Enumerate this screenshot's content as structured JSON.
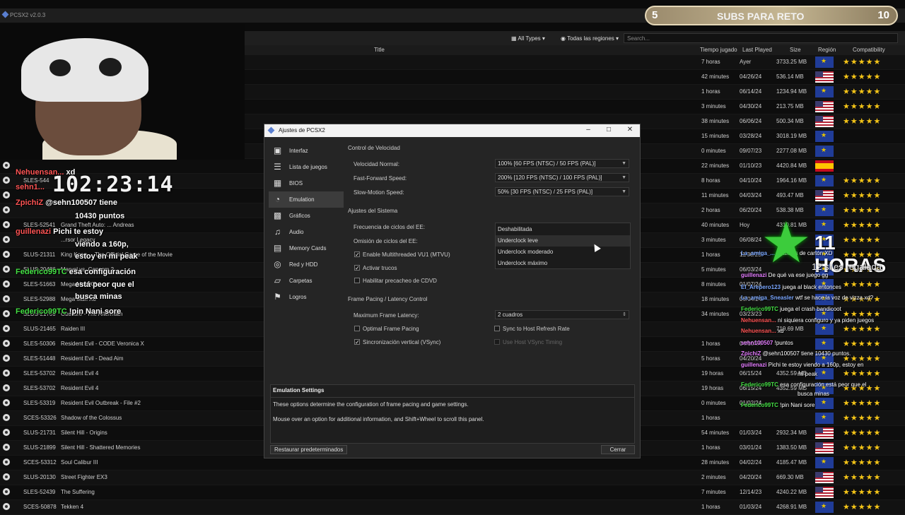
{
  "app": {
    "title": "PCSX2 v2.0.3"
  },
  "toolbar": {
    "types": "All Types",
    "regions": "Todas las regiones",
    "search_placeholder": "Search..."
  },
  "columns": {
    "title": "Title",
    "time": "Tiempo jugado",
    "last": "Last Played",
    "size": "Size",
    "region": "Región",
    "compat": "Compatibility"
  },
  "games": [
    {
      "serial": "",
      "title": "",
      "time": "7 horas",
      "last": "Ayer",
      "size": "3733.25 MB",
      "flag": "eu",
      "stars": 5
    },
    {
      "serial": "",
      "title": "",
      "time": "42 minutes",
      "last": "04/26/24",
      "size": "536.14 MB",
      "flag": "us",
      "stars": 5
    },
    {
      "serial": "",
      "title": "",
      "time": "1 horas",
      "last": "06/14/24",
      "size": "1234.94 MB",
      "flag": "eu",
      "stars": 5
    },
    {
      "serial": "",
      "title": "",
      "time": "3 minutes",
      "last": "04/30/24",
      "size": "213.75 MB",
      "flag": "us",
      "stars": 5
    },
    {
      "serial": "",
      "title": "",
      "time": "38 minutes",
      "last": "06/06/24",
      "size": "500.34 MB",
      "flag": "us",
      "stars": 5
    },
    {
      "serial": "",
      "title": "",
      "time": "15 minutes",
      "last": "03/28/24",
      "size": "3018.19 MB",
      "flag": "eu",
      "stars": 0
    },
    {
      "serial": "",
      "title": "",
      "time": "0 minutes",
      "last": "09/07/23",
      "size": "2277.08 MB",
      "flag": "eu",
      "stars": 0
    },
    {
      "serial": "",
      "title": "",
      "time": "22 minutes",
      "last": "01/10/23",
      "size": "4420.84 MB",
      "flag": "es",
      "stars": 0
    },
    {
      "serial": "SLES-544",
      "title": "",
      "time": "8 horas",
      "last": "04/10/24",
      "size": "1964.16 MB",
      "flag": "eu",
      "stars": 5
    },
    {
      "serial": "",
      "title": "",
      "time": "11 minutes",
      "last": "04/03/24",
      "size": "493.47 MB",
      "flag": "us",
      "stars": 5
    },
    {
      "serial": "",
      "title": "",
      "time": "2 horas",
      "last": "06/20/24",
      "size": "538.38 MB",
      "flag": "eu",
      "stars": 5
    },
    {
      "serial": "SLES-52541",
      "title": "Grand Theft Auto: ... Andreas",
      "time": "40 minutes",
      "last": "Hoy",
      "size": "4310.81 MB",
      "flag": "eu",
      "stars": 5
    },
    {
      "serial": "",
      "title": "...rsor Legacy",
      "time": "3 minutes",
      "last": "06/08/24",
      "size": "",
      "flag": "eu",
      "stars": 5
    },
    {
      "serial": "SLUS-21311",
      "title": "King Kong ... The Official Game of the Movie",
      "time": "1 horas",
      "last": "11/30/23",
      "size": "",
      "flag": "eu",
      "stars": 5
    },
    {
      "serial": "SLUS-20486",
      "title": "Marvel vs. Capcom 2",
      "time": "5 minutes",
      "last": "06/03/24",
      "size": "",
      "flag": "eu",
      "stars": 5
    },
    {
      "serial": "SLES-51663",
      "title": "Mega Man X7",
      "time": "8 minutes",
      "last": "01/07/24",
      "size": "",
      "flag": "eu",
      "stars": 5
    },
    {
      "serial": "SLES-52988",
      "title": "Mega Man X8",
      "time": "18 minutes",
      "last": "05/04/24",
      "size": "",
      "flag": "eu",
      "stars": 5
    },
    {
      "serial": "SLUS-21709",
      "title": "Obscure - The Aftermath",
      "time": "34 minutes",
      "last": "03/23/23",
      "size": "",
      "flag": "eu",
      "stars": 5
    },
    {
      "serial": "SLUS-21465",
      "title": "Raiden III",
      "time": "",
      "last": "",
      "size": "719.69 MB",
      "flag": "eu",
      "stars": 5
    },
    {
      "serial": "SLES-50306",
      "title": "Resident Evil - CODE Veronica X",
      "time": "1 horas",
      "last": "04/10/24",
      "size": "",
      "flag": "eu",
      "stars": 5
    },
    {
      "serial": "SLES-51448",
      "title": "Resident Evil - Dead Aim",
      "time": "5 horas",
      "last": "04/20/24",
      "size": "",
      "flag": "eu",
      "stars": 5
    },
    {
      "serial": "SLES-53702",
      "title": "Resident Evil 4",
      "time": "19 horas",
      "last": "06/15/24",
      "size": "4352.59 MB",
      "flag": "eu",
      "stars": 5
    },
    {
      "serial": "SLES-53702",
      "title": "Resident Evil 4",
      "time": "19 horas",
      "last": "06/15/24",
      "size": "4352.59 MB",
      "flag": "eu",
      "stars": 5
    },
    {
      "serial": "SLES-53319",
      "title": "Resident Evil Outbreak - File #2",
      "time": "0 minutes",
      "last": "01/02/24",
      "size": "",
      "flag": "eu",
      "stars": 5
    },
    {
      "serial": "SCES-53326",
      "title": "Shadow of the Colossus",
      "time": "1 horas",
      "last": "",
      "size": "",
      "flag": "eu",
      "stars": 5
    },
    {
      "serial": "SLUS-21731",
      "title": "Silent Hill - Origins",
      "time": "54 minutes",
      "last": "01/03/24",
      "size": "2932.34 MB",
      "flag": "us",
      "stars": 5
    },
    {
      "serial": "SLUS-21899",
      "title": "Silent Hill - Shattered Memories",
      "time": "1 horas",
      "last": "03/01/24",
      "size": "1383.50 MB",
      "flag": "us",
      "stars": 5
    },
    {
      "serial": "SCES-53312",
      "title": "Soul Calibur III",
      "time": "28 minutes",
      "last": "04/02/24",
      "size": "4185.47 MB",
      "flag": "eu",
      "stars": 5
    },
    {
      "serial": "SLUS-20130",
      "title": "Street Fighter EX3",
      "time": "2 minutes",
      "last": "04/20/24",
      "size": "669.30 MB",
      "flag": "us",
      "stars": 5
    },
    {
      "serial": "SLES-52439",
      "title": "The Suffering",
      "time": "7 minutes",
      "last": "12/14/23",
      "size": "4240.22 MB",
      "flag": "us",
      "stars": 5
    },
    {
      "serial": "SCES-50878",
      "title": "Tekken 4",
      "time": "1 horas",
      "last": "01/03/24",
      "size": "4268.91 MB",
      "flag": "eu",
      "stars": 5
    }
  ],
  "overlay": {
    "timer": "102:23:14",
    "subs_left": "5",
    "subs_label": "SUBS PARA RETO",
    "subs_right": "10",
    "hours_big": "11 HORAS",
    "hours_sub": "12 si es regalada"
  },
  "chat_left": [
    {
      "user": "Nehuensan...",
      "text": " xd"
    },
    {
      "user": "sehn1...",
      "text": ""
    },
    {
      "user": "ZpichiZ",
      "text": " @sehn100507 tiene"
    },
    {
      "user": "",
      "text": "10430 puntos"
    },
    {
      "user": "guillenazi",
      "text": " Pichi te estoy"
    },
    {
      "user": "",
      "text": "viendo a 160p,"
    },
    {
      "user": "",
      "text": "estoy en mi peak"
    },
    {
      "user": "Federico99TC",
      "text": " esa configuración"
    },
    {
      "user": "",
      "text": "está peor que el"
    },
    {
      "user": "",
      "text": "busca minas"
    },
    {
      "user": "Federico99TC",
      "text": " !pin Nani sore"
    }
  ],
  "chat_right": [
    {
      "user": "La_amiga_...",
      "text": " ...ráficos de cartón XD"
    },
    {
      "user": "guillenazi",
      "text": " De qué va ese juego gg"
    },
    {
      "user": "El_Arepero123",
      "text": " juega al black entonces"
    },
    {
      "user": "La_amiga_Sneasler",
      "text": " wtf se hace la voz de vizza xd?"
    },
    {
      "user": "Federico99TC",
      "text": " juega el crash bandicoot"
    },
    {
      "user": "Nehuensan...",
      "text": " ni siquiera configuro y ya piden juegos"
    },
    {
      "user": "Nehuensan...",
      "text": " xd"
    },
    {
      "user": "sehn100507",
      "text": " !puntos"
    },
    {
      "user": "ZpichiZ",
      "text": " @sehn100507 tiene 10430 puntos."
    },
    {
      "user": "guillenazi",
      "text": " Pichi te estoy viendo a 160p, estoy en"
    },
    {
      "user": "",
      "text": "mi peak"
    },
    {
      "user": "Federico99TC",
      "text": " esa configuración está peor que el"
    },
    {
      "user": "",
      "text": "busca minas"
    },
    {
      "user": "Federico99TC",
      "text": " !pin Nani sore"
    }
  ],
  "dialog": {
    "title": "Ajustes de PCSX2",
    "nav": [
      {
        "label": "Interfaz",
        "icon": "▣"
      },
      {
        "label": "Lista de juegos",
        "icon": "☰"
      },
      {
        "label": "BIOS",
        "icon": "▦"
      },
      {
        "label": "Emulation",
        "icon": "◔"
      },
      {
        "label": "Gráficos",
        "icon": "▩"
      },
      {
        "label": "Audio",
        "icon": "♫"
      },
      {
        "label": "Memory Cards",
        "icon": "▤"
      },
      {
        "label": "Red y HDD",
        "icon": "◎"
      },
      {
        "label": "Carpetas",
        "icon": "▱"
      },
      {
        "label": "Logros",
        "icon": "⚑"
      }
    ],
    "section_speed": "Control de Velocidad",
    "normal_speed_label": "Velocidad Normal:",
    "normal_speed_value": "100% [60 FPS (NTSC) / 50 FPS (PAL)]",
    "ff_label": "Fast-Forward Speed:",
    "ff_value": "200% [120 FPS (NTSC) / 100 FPS (PAL)]",
    "slow_label": "Slow-Motion Speed:",
    "slow_value": "50% [30 FPS (NTSC) / 25 FPS (PAL)]",
    "section_system": "Ajustes del Sistema",
    "ee_freq_label": "Frecuencia de ciclos del EE:",
    "ee_skip_label": "Omisión de ciclos del EE:",
    "mtvu_label": "Enable Multithreaded VU1 (MTVU)",
    "cheats_label": "Activar trucos",
    "cdvd_label": "Habilitar precacheo de CDVD",
    "dropdown_options": [
      "Deshabilitada",
      "Underclock leve",
      "Underclock moderado",
      "Underclock máximo"
    ],
    "section_frame": "Frame Pacing / Latency Control",
    "max_latency_label": "Maximum Frame Latency:",
    "max_latency_value": "2 cuadros",
    "optimal_pacing_label": "Optimal Frame Pacing",
    "vsync_label": "Sincronización vertical (VSync)",
    "sync_host_label": "Sync to Host Refresh Rate",
    "host_vsync_label": "Use Host VSync Timing",
    "help_title": "Emulation Settings",
    "help_line1": "These options determine the configuration of frame pacing and game settings.",
    "help_line2": "Mouse over an option for additional information, and Shift+Wheel to scroll this panel.",
    "restore_button": "Restaurar predeterminados",
    "close_button": "Cerrar"
  }
}
